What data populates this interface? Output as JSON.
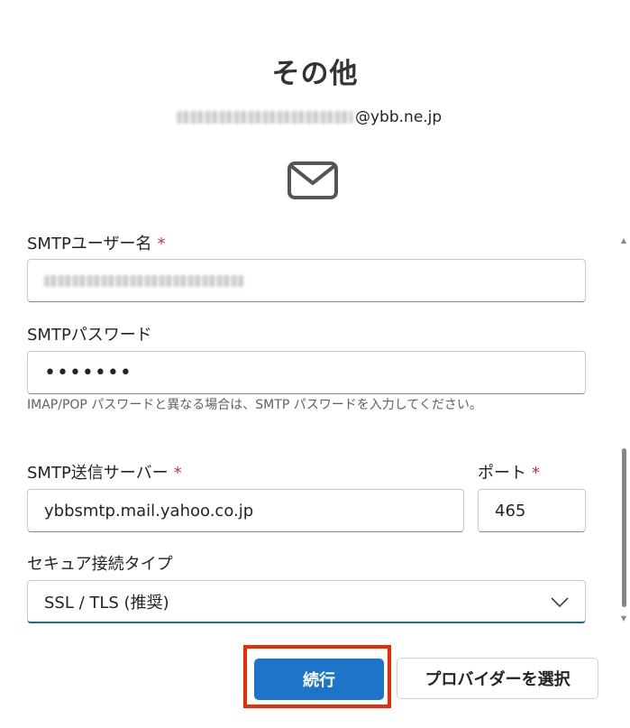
{
  "header": {
    "title": "その他",
    "email_suffix": "@ybb.ne.jp",
    "icon": "envelope-icon"
  },
  "form": {
    "smtp_username": {
      "label": "SMTPユーザー名",
      "required_mark": "*"
    },
    "smtp_password": {
      "label": "SMTPパスワード",
      "value_masked": "•••••••",
      "hint": "IMAP/POP パスワードと異なる場合は、SMTP パスワードを入力してください。"
    },
    "smtp_server": {
      "label": "SMTP送信サーバー",
      "required_mark": "*",
      "value": "ybbsmtp.mail.yahoo.co.jp"
    },
    "port": {
      "label": "ポート",
      "required_mark": "*",
      "value": "465"
    },
    "security_type": {
      "label": "セキュア接続タイプ",
      "selected": "SSL / TLS (推奨)"
    }
  },
  "actions": {
    "continue_label": "続行",
    "choose_provider_label": "プロバイダーを選択"
  },
  "colors": {
    "primary": "#1e74c9",
    "required": "#c4314b",
    "highlight": "#ee2a00",
    "select_underline": "#0f6cbd"
  }
}
